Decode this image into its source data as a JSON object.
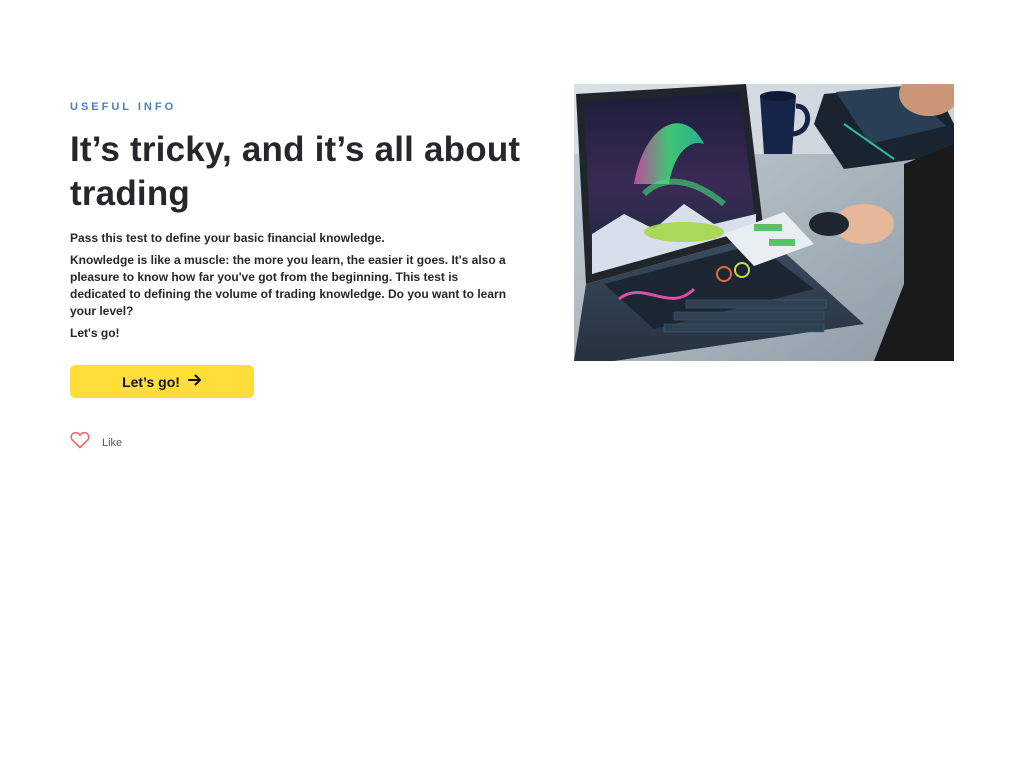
{
  "section": {
    "eyebrow": "USEFUL INFO",
    "title": "It’s tricky, and it’s all about trading",
    "lead": "Pass this test to define your basic financial knowledge.",
    "description": "Knowledge is like a muscle: the more you learn, the easier it goes. It's also a pleasure to know how far you've got from the beginning. This test is dedicated to defining the volume of trading knowledge. Do you want to learn your level?",
    "cta_text": "Let's go!",
    "button_label": "Let’s go!",
    "like_label": "Like"
  },
  "colors": {
    "accent": "#ffde3a",
    "eyebrow": "#4a7fc1",
    "heart": "#e86a6a",
    "text": "#26272b"
  },
  "icons": {
    "button_icon": "arrow-right-icon",
    "like_icon": "heart-icon"
  }
}
